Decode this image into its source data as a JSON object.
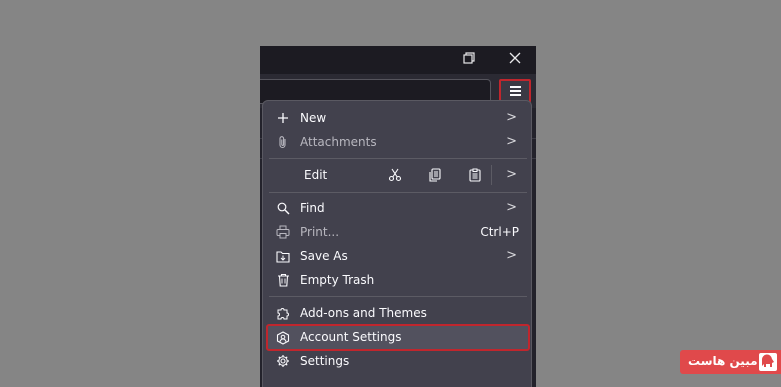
{
  "window": {
    "restore_icon": "restore-icon",
    "close_icon": "close-icon"
  },
  "toolbar": {
    "menu_button_icon": "hamburger-icon",
    "highlight_color": "#c0262d"
  },
  "menu": {
    "new_label": "New",
    "attachments_label": "Attachments",
    "edit": {
      "label": "Edit",
      "cut_icon": "scissors-icon",
      "copy_icon": "copy-icon",
      "paste_icon": "paste-icon"
    },
    "find_label": "Find",
    "print_label": "Print...",
    "print_shortcut": "Ctrl+P",
    "save_as_label": "Save As",
    "empty_trash_label": "Empty Trash",
    "addons_label": "Add-ons and Themes",
    "account_settings_label": "Account Settings",
    "settings_label": "Settings"
  },
  "watermark": {
    "text": "مبین هاست",
    "logo_icon": "elephant-logo-icon"
  }
}
